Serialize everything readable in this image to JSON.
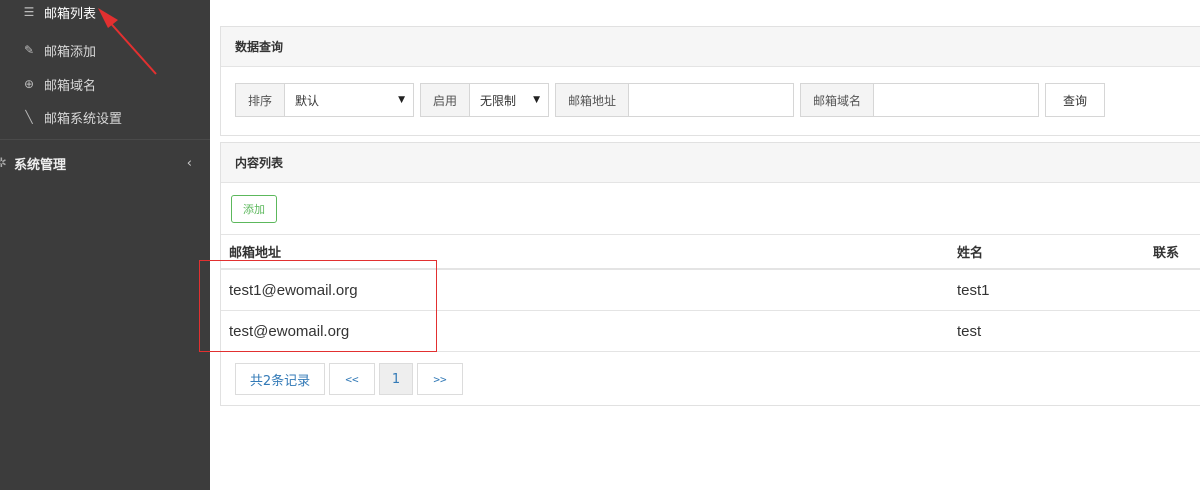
{
  "sidebar": {
    "items": [
      {
        "icon": "list-icon",
        "glyph": "☰",
        "label": "邮箱列表"
      },
      {
        "icon": "pencil-icon",
        "glyph": "✎",
        "label": "邮箱添加"
      },
      {
        "icon": "globe-icon",
        "glyph": "⊕",
        "label": "邮箱域名"
      },
      {
        "icon": "wrench-icon",
        "glyph": "╲",
        "label": "邮箱系统设置"
      }
    ],
    "group": {
      "icon": "gear-icon",
      "glyph": "✲",
      "label": "系统管理",
      "chevron": "‹"
    }
  },
  "query": {
    "title": "数据查询",
    "sort_label": "排序",
    "sort_value": "默认",
    "enable_label": "启用",
    "enable_value": "无限制",
    "caret": "▼",
    "email_label": "邮箱地址",
    "email_value": "",
    "domain_label": "邮箱域名",
    "domain_value": "",
    "search_button": "查询"
  },
  "list": {
    "title": "内容列表",
    "add_button": "添加",
    "columns": [
      "邮箱地址",
      "姓名",
      "联系"
    ],
    "rows": [
      {
        "email": "test1@ewomail.org",
        "name": "test1",
        "contact": ""
      },
      {
        "email": "test@ewomail.org",
        "name": "test",
        "contact": ""
      }
    ],
    "pager": {
      "total": "共2条记录",
      "prev": "<<",
      "current": "1",
      "next": ">>"
    }
  },
  "colors": {
    "sidebar_bg": "#3c3c3c",
    "add_green": "#5cb85c",
    "link_blue": "#337ab7",
    "annotation_red": "#e23030"
  }
}
